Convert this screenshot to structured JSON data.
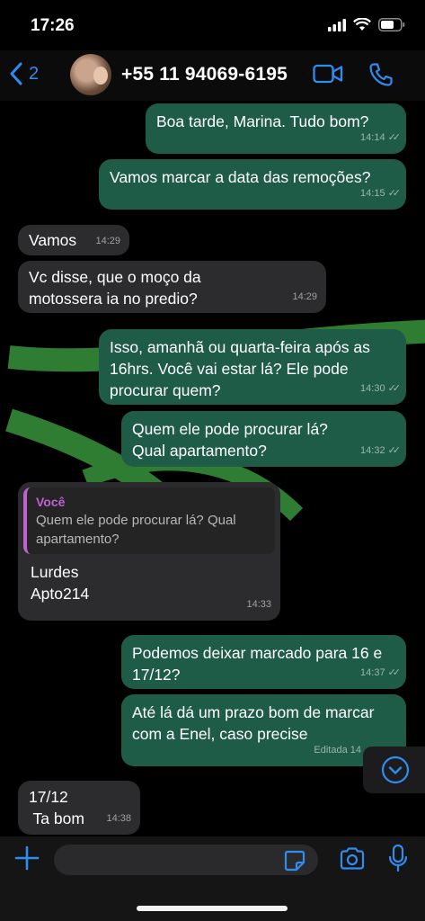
{
  "status_bar": {
    "time": "17:26"
  },
  "header": {
    "back_count": "2",
    "contact_name": "+55 11 94069-6195"
  },
  "messages": [
    {
      "dir": "out",
      "text": "Boa tarde, Marina. Tudo bom?",
      "time": "14:14",
      "ticks": "✓✓"
    },
    {
      "dir": "out",
      "text": "Vamos marcar a  data das remoções?",
      "time": "14:15",
      "ticks": "✓✓"
    },
    {
      "dir": "in",
      "text": "Vamos",
      "time": "14:29"
    },
    {
      "dir": "in",
      "text": "Vc disse, que o moço da motossera ia no predio?",
      "time": "14:29"
    },
    {
      "dir": "out",
      "text": "Isso, amanhã ou quarta-feira após as 16hrs. Você vai estar lá? Ele pode procurar quem?",
      "time": "14:30",
      "ticks": "✓✓"
    },
    {
      "dir": "out",
      "text": "Quem ele pode procurar lá? Qual apartamento?",
      "time": "14:32",
      "ticks": "✓✓"
    },
    {
      "dir": "in",
      "quote_author": "Você",
      "quote_text": "Quem ele pode procurar lá? Qual apartamento?",
      "line1": "Lurdes",
      "line2": "Apto214",
      "time": "14:33"
    },
    {
      "dir": "out",
      "text": "Podemos deixar marcado para 16 e 17/12?",
      "time": "14:37",
      "ticks": "✓✓"
    },
    {
      "dir": "out",
      "text": "Até lá dá um prazo bom de marcar com a Enel, caso precise",
      "time": "Editada 14"
    },
    {
      "dir": "in",
      "line1": "17/12",
      "line2": " Ta bom",
      "time": "14:38"
    }
  ],
  "composer": {
    "placeholder": ""
  },
  "icons": {
    "back": "chevron-left-icon",
    "video": "video-camera-icon",
    "call": "phone-icon",
    "scroll_down": "chevron-down-circle-icon",
    "attach": "plus-icon",
    "sticker": "sticker-icon",
    "camera": "camera-icon",
    "mic": "microphone-icon"
  },
  "colors": {
    "accent": "#2f8cf0",
    "outgoing": "#1f5c47",
    "incoming": "#2c2c2e",
    "quote_author": "#c062d2"
  }
}
